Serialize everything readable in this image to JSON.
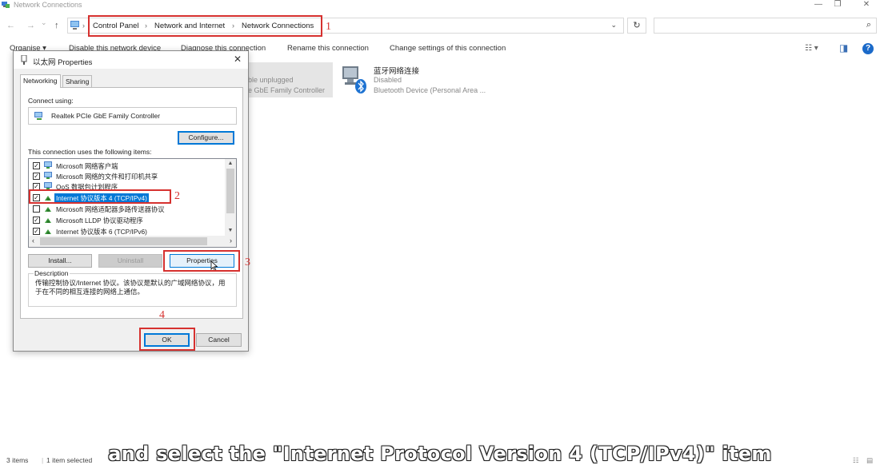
{
  "window": {
    "title": "Network Connections",
    "controls": {
      "minimize": "—",
      "restore": "❐",
      "close": "✕"
    }
  },
  "nav": {
    "back_icon": "←",
    "forward_icon": "→",
    "recent_icon": "⌄",
    "up_icon": "↑",
    "breadcrumb": [
      "Control Panel",
      "Network and Internet",
      "Network Connections"
    ],
    "breadcrumb_sep": "›",
    "dropdown_icon": "⌄",
    "refresh_icon": "↻",
    "search_placeholder": "",
    "search_icon": "⌕"
  },
  "commandbar": {
    "organise": "Organise ▾",
    "disable_device": "Disable this network device",
    "diagnose": "Diagnose this connection",
    "rename": "Rename this connection",
    "change_settings": "Change settings of this connection",
    "view_icons": "☷ ▾",
    "pane_icon": "◨",
    "help_icon": "?"
  },
  "network_items": [
    {
      "name": "",
      "status": "Network cable unplugged",
      "device": "Realtek PCIe GbE Family Controller",
      "status_visible": "ble unplugged",
      "device_visible": "e GbE Family Controller"
    },
    {
      "name": "蓝牙网络连接",
      "status": "Disabled",
      "device": "Bluetooth Device (Personal Area ..."
    }
  ],
  "dialog": {
    "title": "以太网 Properties",
    "close_icon": "✕",
    "tabs": [
      "Networking",
      "Sharing"
    ],
    "connect_using_label": "Connect using:",
    "adapter": "Realtek PCIe GbE Family Controller",
    "configure_button": "Configure...",
    "items_label": "This connection uses the following items:",
    "items": [
      {
        "label": "Microsoft 网络客户端",
        "checked": true
      },
      {
        "label": "Microsoft 网络的文件和打印机共享",
        "checked": true
      },
      {
        "label": "QoS 数据包计划程序",
        "checked": true
      },
      {
        "label": "Internet 协议版本 4 (TCP/IPv4)",
        "checked": true,
        "selected": true
      },
      {
        "label": "Microsoft 网络适配器多路传送器协议",
        "checked": false
      },
      {
        "label": "Microsoft LLDP 协议驱动程序",
        "checked": true
      },
      {
        "label": "Internet 协议版本 6 (TCP/IPv6)",
        "checked": true
      }
    ],
    "check_mark": "✓",
    "scroll_up": "▲",
    "scroll_down": "▼",
    "scroll_left": "‹",
    "scroll_right": "›",
    "install_button": "Install...",
    "uninstall_button": "Uninstall",
    "properties_button": "Properties",
    "description_title": "Description",
    "description_text": "传输控制协议/Internet 协议。该协议是默认的广域网络协议，用于在不同的相互连接的网络上通信。",
    "ok_button": "OK",
    "cancel_button": "Cancel"
  },
  "annotations": [
    "1",
    "2",
    "3",
    "4"
  ],
  "annotation_color": "#d6312f",
  "statusbar": {
    "items_count": "3 items",
    "selected_count": "1 item selected"
  },
  "caption": "and select the \"Internet Protocol Version 4 (TCP/IPv4)\" item"
}
